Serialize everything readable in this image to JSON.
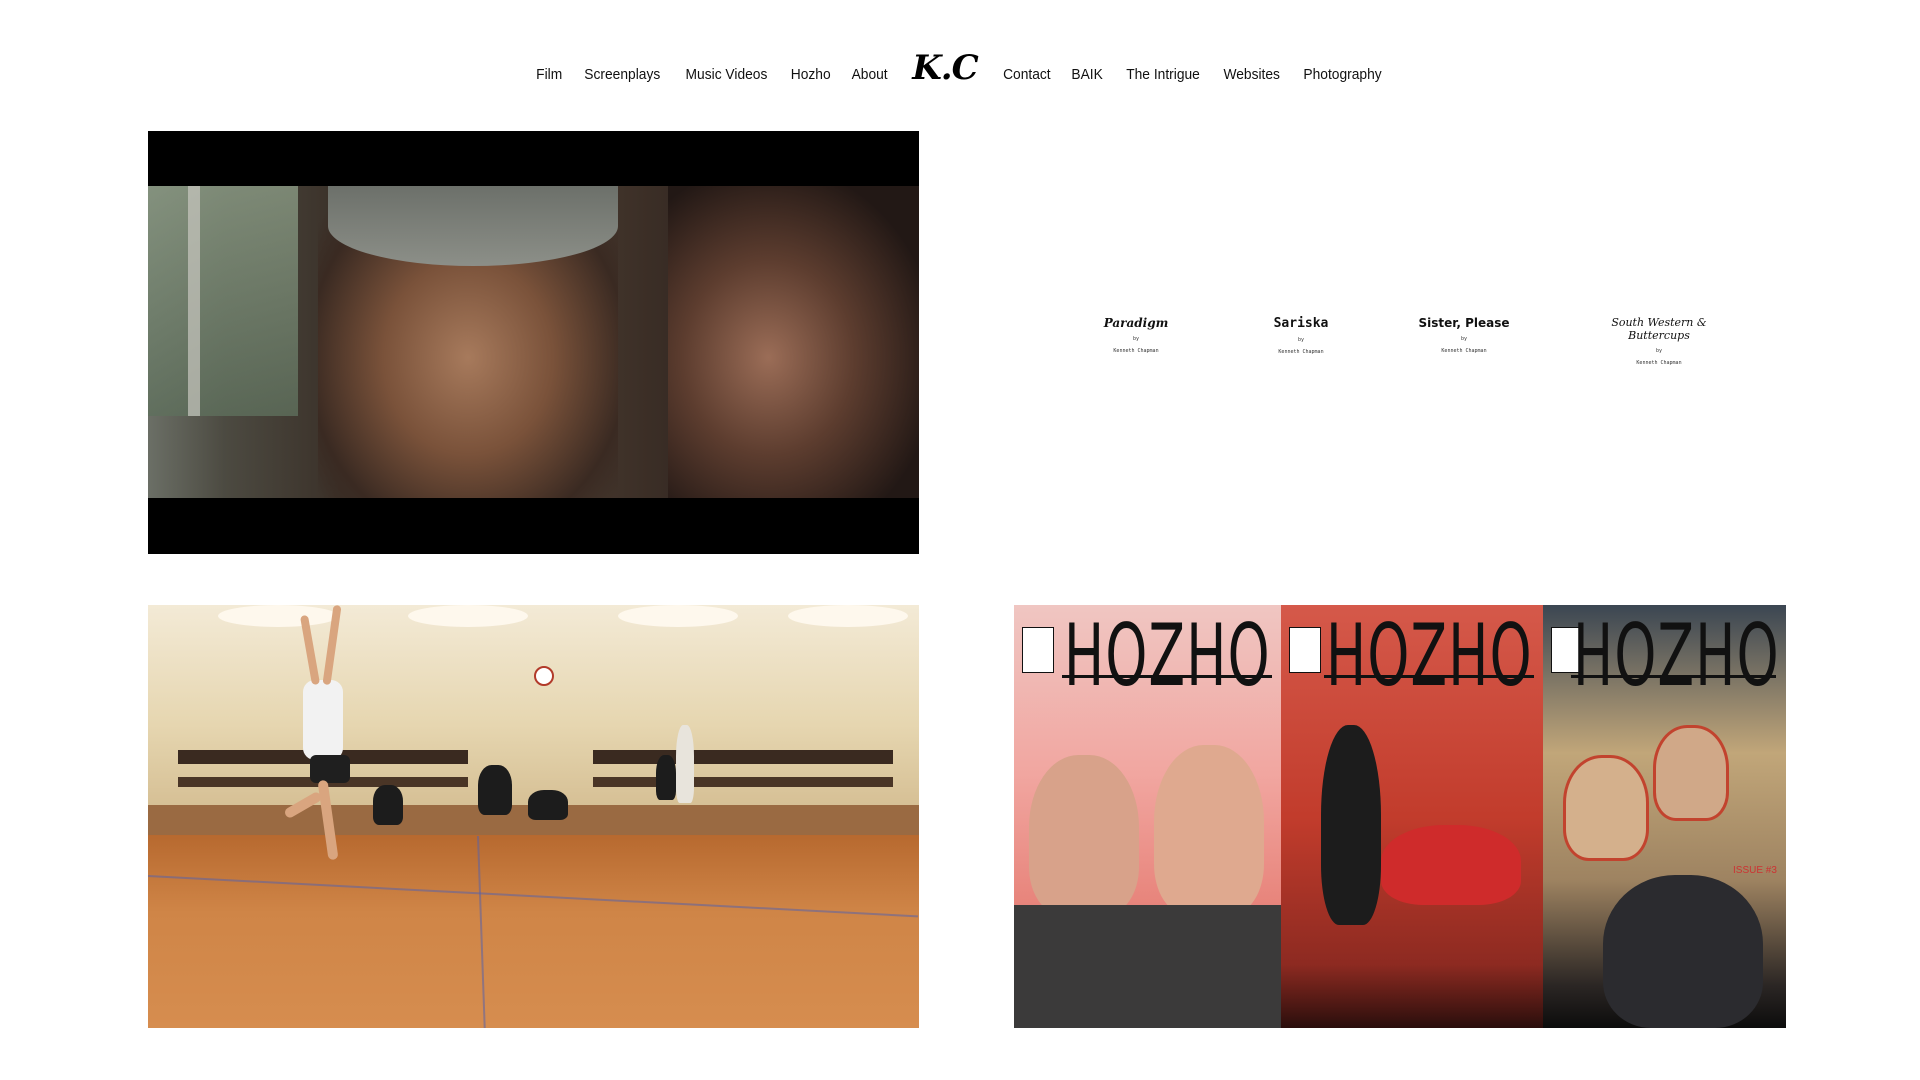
{
  "nav": {
    "items_left": [
      "Film",
      "Screenplays",
      "Music Videos",
      "Hozho",
      "About"
    ],
    "logo": "K.C",
    "items_right": [
      "Contact",
      "BAIK",
      "The Intrigue",
      "Websites",
      "Photography"
    ]
  },
  "screenplays": [
    {
      "title": "Paradigm",
      "by": "by",
      "author": "Kenneth Chapman"
    },
    {
      "title": "Sariska",
      "by": "by",
      "author": "Kenneth Chapman"
    },
    {
      "title": "Sister, Please",
      "by": "by",
      "author": "Kenneth Chapman"
    },
    {
      "title": "South Western & Buttercups",
      "by": "by",
      "author": "Kenneth Chapman"
    }
  ],
  "comics": {
    "title": "HOZHO",
    "issue_label": "ISSUE #3"
  }
}
